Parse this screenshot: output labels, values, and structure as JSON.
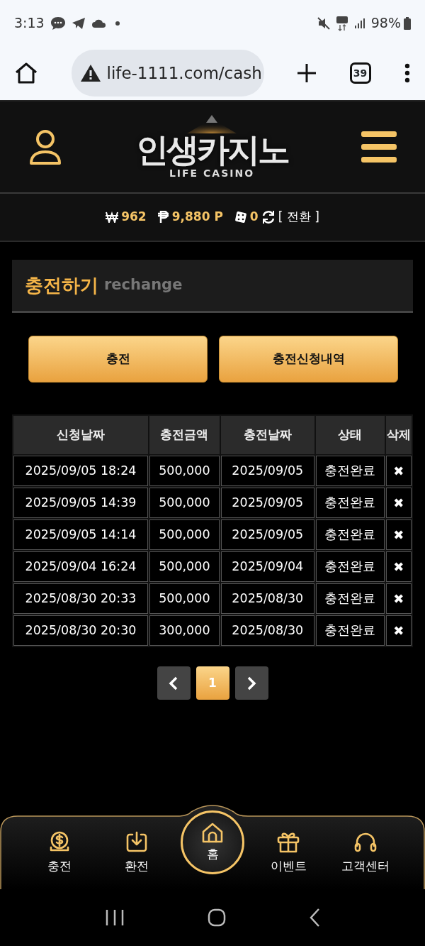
{
  "status_bar": {
    "time": "3:13",
    "battery": "98%"
  },
  "browser": {
    "url": "life-1111.com/cash",
    "tab_count": "39"
  },
  "header": {
    "logo_title": "인생카지노",
    "logo_subtitle": "LIFE CASINO"
  },
  "balance": {
    "cash": "962",
    "points": "9,880 P",
    "chips": "0",
    "switch": "[ 전환 ]"
  },
  "section": {
    "title": "충전하기",
    "subtitle": "rechange"
  },
  "buttons": [
    "충전",
    "충전신청내역"
  ],
  "table": {
    "columns": [
      "신청날짜",
      "충전금액",
      "충전날짜",
      "상태",
      "삭제"
    ],
    "rows": [
      {
        "cells": [
          "2025/09/05 18:24",
          "500,000",
          "2025/09/05",
          "충전완료"
        ],
        "delete": "✖"
      },
      {
        "cells": [
          "2025/09/05 14:39",
          "500,000",
          "2025/09/05",
          "충전완료"
        ],
        "delete": "✖"
      },
      {
        "cells": [
          "2025/09/05 14:14",
          "500,000",
          "2025/09/05",
          "충전완료"
        ],
        "delete": "✖"
      },
      {
        "cells": [
          "2025/09/04 16:24",
          "500,000",
          "2025/09/04",
          "충전완료"
        ],
        "delete": "✖"
      },
      {
        "cells": [
          "2025/08/30 20:33",
          "500,000",
          "2025/08/30",
          "충전완료"
        ],
        "delete": "✖"
      },
      {
        "cells": [
          "2025/08/30 20:30",
          "300,000",
          "2025/08/30",
          "충전완료"
        ],
        "delete": "✖"
      }
    ]
  },
  "pagination": {
    "pages": [
      {
        "label": "1",
        "selected": true
      }
    ]
  },
  "bottom_nav": [
    {
      "label": "충전",
      "kind": "deposit",
      "selected": false
    },
    {
      "label": "환전",
      "kind": "withdraw",
      "selected": false
    },
    {
      "label": "홈",
      "kind": "home",
      "selected": true
    },
    {
      "label": "이벤트",
      "kind": "event",
      "selected": false
    },
    {
      "label": "고객센터",
      "kind": "support",
      "selected": false
    }
  ]
}
